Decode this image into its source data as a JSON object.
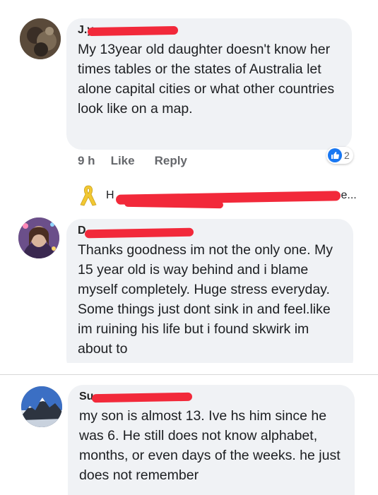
{
  "comments": [
    {
      "author_visible": "J.y",
      "text": "My 13year old daughter doesn't know her times tables or the states of Australia let alone capital cities or what other countries look like on a map.",
      "time": "9 h",
      "like_label": "Like",
      "reply_label": "Reply",
      "reaction_count": "2",
      "avatar_icon": "profile-photo"
    },
    {
      "author_visible": "D",
      "text": "Thanks goodness im not the only one. My 15 year old is way behind and i blame myself completely. Huge stress everyday. Some things just dont sink in and feel.like im ruining his life but i found skwirk im about to",
      "avatar_icon": "profile-photo"
    },
    {
      "author_visible": "Su",
      "text": "my son is almost 13. Ive hs him since he was 6. He still does not know alphabet, months, or even days of the weeks. he just does not remember",
      "avatar_icon": "mountain-photo"
    }
  ],
  "reply_preview": {
    "author_initial": "H",
    "snippet_end": "e...",
    "icon": "yellow-ribbon-icon"
  },
  "colors": {
    "bubble": "#f0f2f5",
    "redaction": "#f2293a",
    "like_blue": "#1877f2",
    "meta_gray": "#65676b"
  }
}
